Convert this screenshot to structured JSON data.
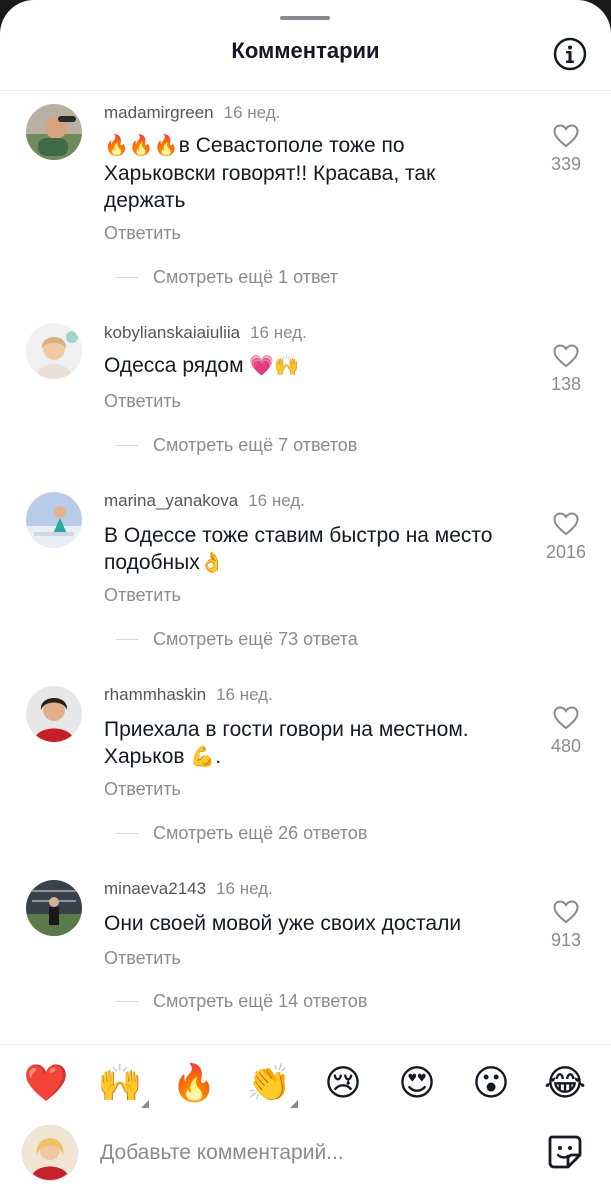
{
  "header": {
    "title": "Комментарии",
    "info_icon": "info-icon"
  },
  "comments": [
    {
      "username": "madamirgreen",
      "time": "16 нед.",
      "text_line1_prefix": "🔥🔥🔥",
      "text_line1": "в Севастополе тоже по",
      "text_line2": "Харьковски говорят!! Красава, так",
      "text_line3": "держать",
      "reply_label": "Ответить",
      "likes": "339",
      "more_replies": "Смотреть ещё 1 ответ"
    },
    {
      "username": "kobylianskaiaiuliia",
      "time": "16 нед.",
      "text_line1": "Одесса рядом",
      "text_emoji": "💗🙌",
      "reply_label": "Ответить",
      "likes": "138",
      "more_replies": "Смотреть ещё 7 ответов"
    },
    {
      "username": "marina_yanakova",
      "time": "16 нед.",
      "text_line1": "В Одессе тоже ставим быстро на место",
      "text_line2": "подобных",
      "text_emoji": "👌",
      "reply_label": "Ответить",
      "likes": "2016",
      "more_replies": "Смотреть ещё 73 ответа"
    },
    {
      "username": "rhammhaskin",
      "time": "16 нед.",
      "text_line1": "Приехала в гости говори на местном.",
      "text_line2": "Харьков",
      "text_emoji": "💪",
      "text_tail": ".",
      "reply_label": "Ответить",
      "likes": "480",
      "more_replies": "Смотреть ещё 26 ответов"
    },
    {
      "username": "minaeva2143",
      "time": "16 нед.",
      "text_line1": "Они своей мовой уже своих достали",
      "reply_label": "Ответить",
      "likes": "913",
      "more_replies": "Смотреть ещё 14 ответов"
    }
  ],
  "emoji_bar": [
    "❤️",
    "🙌",
    "🔥",
    "👏",
    "😢",
    "😍",
    "😮",
    "😂"
  ],
  "composer": {
    "placeholder": "Добавьте комментарий...",
    "sticker_icon": "sticker-icon"
  },
  "colors": {
    "text_primary": "#161823",
    "text_secondary": "#8a8b91",
    "heart": "#fe2c55"
  }
}
